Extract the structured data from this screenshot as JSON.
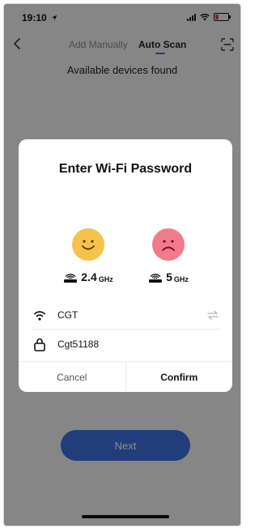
{
  "status_bar": {
    "time": "19:10",
    "icons": [
      "location-arrow-icon",
      "signal-icon",
      "wifi-icon",
      "battery-low-icon"
    ]
  },
  "nav": {
    "back_icon": "chevron-left-icon",
    "tabs": [
      {
        "label": "Add Manually",
        "active": false
      },
      {
        "label": "Auto Scan",
        "active": true
      }
    ],
    "scan_icon": "scan-frame-icon"
  },
  "page": {
    "subtitle": "Available devices found",
    "next_label": "Next"
  },
  "dialog": {
    "title": "Enter Wi-Fi Password",
    "bands": [
      {
        "label_num": "2.4",
        "label_unit": "GHz",
        "status": "supported",
        "face_icon": "smile-face-icon",
        "color": "#f7c24a"
      },
      {
        "label_num": "5",
        "label_unit": "GHz",
        "status": "not-supported",
        "face_icon": "sad-face-icon",
        "color": "#f27b8a"
      }
    ],
    "ssid": "CGT",
    "password": "Cgt51188",
    "cancel_label": "Cancel",
    "confirm_label": "Confirm"
  },
  "colors": {
    "accent": "#3c6fe0",
    "overlay": "rgba(0,0,0,0.45)",
    "smile": "#f7c24a",
    "sad": "#f27b8a"
  }
}
